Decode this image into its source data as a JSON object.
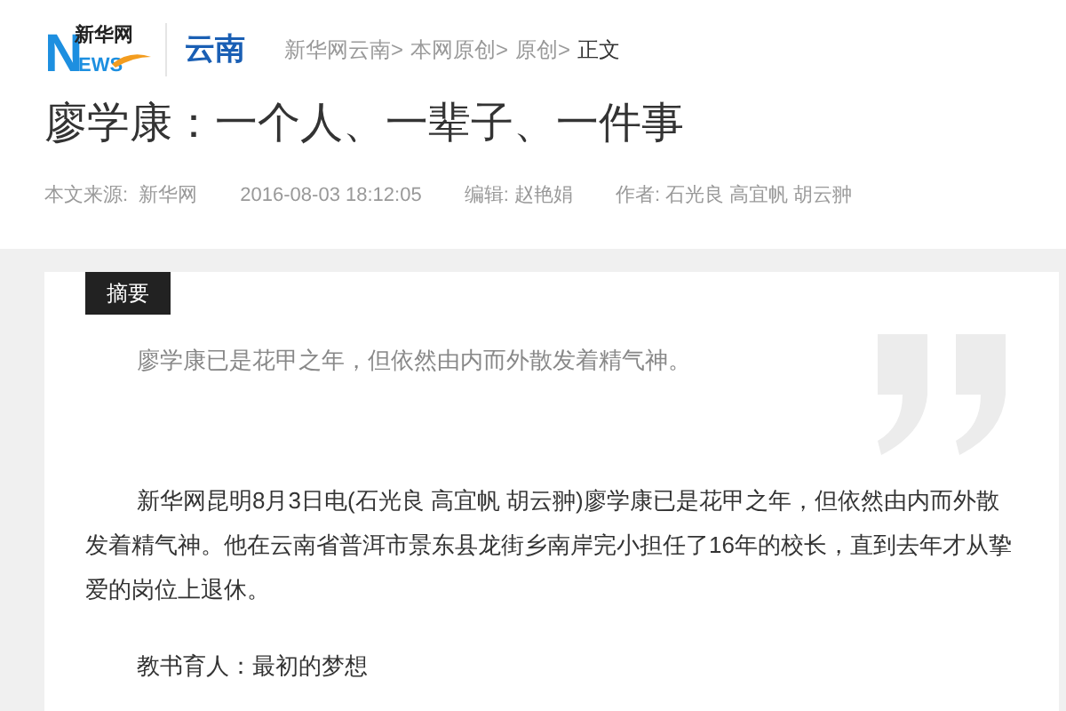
{
  "logo": {
    "initial": "N",
    "name": "新华网",
    "rest": "EWS"
  },
  "channel": "云南",
  "breadcrumb": [
    {
      "label": "新华网云南>",
      "current": false
    },
    {
      "label": "本网原创>",
      "current": false
    },
    {
      "label": "原创>",
      "current": false
    },
    {
      "label": "正文",
      "current": true
    }
  ],
  "title": "廖学康：一个人、一辈子、一件事",
  "meta": [
    "本文来源:  新华网",
    "2016-08-03 18:12:05",
    "编辑: 赵艳娟",
    "作者: 石光良 高宜帆 胡云翀"
  ],
  "summary": {
    "tag": "摘要",
    "text": "廖学康已是花甲之年，但依然由内而外散发着精气神。"
  },
  "paragraphs": [
    "新华网昆明8月3日电(石光良 高宜帆 胡云翀)廖学康已是花甲之年，但依然由内而外散发着精气神。他在云南省普洱市景东县龙街乡南岸完小担任了16年的校长，直到去年才从挚爱的岗位上退休。",
    "教书育人：最初的梦想"
  ]
}
